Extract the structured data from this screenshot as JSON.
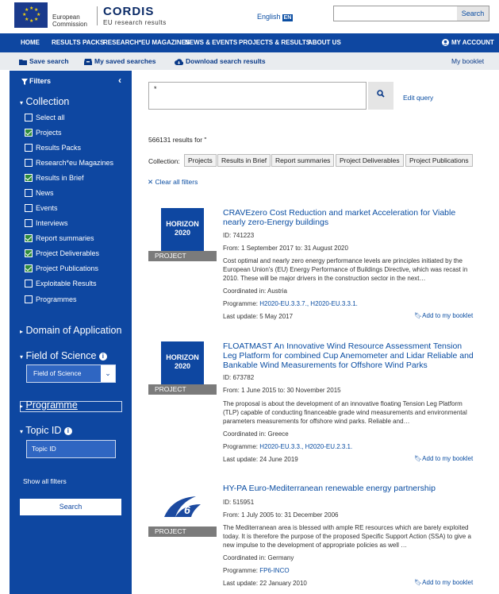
{
  "header": {
    "ec_line1": "European",
    "ec_line2": "Commission",
    "site_name": "CORDIS",
    "site_subtitle": "EU research results",
    "language": "English",
    "language_code": "EN",
    "search_button": "Search",
    "search_value": ""
  },
  "nav": {
    "items": [
      "HOME",
      "RESULTS PACKS",
      "RESEARCH*EU MAGAZINES",
      "NEWS & EVENTS",
      "PROJECTS & RESULTS",
      "ABOUT US"
    ],
    "account": "MY ACCOUNT"
  },
  "toolbar": {
    "save_search": "Save search",
    "saved_searches": "My saved searches",
    "download": "Download search results",
    "booklet": "My booklet"
  },
  "sidebar": {
    "filters": "Filters",
    "collection": {
      "title": "Collection",
      "items": [
        {
          "label": "Select all",
          "checked": false
        },
        {
          "label": "Projects",
          "checked": true
        },
        {
          "label": "Results Packs",
          "checked": false
        },
        {
          "label": "Research*eu Magazines",
          "checked": false
        },
        {
          "label": "Results in Brief",
          "checked": true
        },
        {
          "label": "News",
          "checked": false
        },
        {
          "label": "Events",
          "checked": false
        },
        {
          "label": "Interviews",
          "checked": false
        },
        {
          "label": "Report summaries",
          "checked": true
        },
        {
          "label": "Project Deliverables",
          "checked": true
        },
        {
          "label": "Project Publications",
          "checked": true
        },
        {
          "label": "Exploitable Results",
          "checked": false
        },
        {
          "label": "Programmes",
          "checked": false
        }
      ]
    },
    "domain": "Domain of Application",
    "field_of_science": "Field of Science",
    "field_select": "Field of Science",
    "programme": "Programme",
    "topic_id": "Topic ID",
    "topic_placeholder": "Topic ID",
    "show_all": "Show all filters",
    "search_button": "Search"
  },
  "main": {
    "query": "*",
    "edit_query": "Edit query",
    "results_count": "566131 results for \"",
    "collection_label": "Collection:",
    "chips": [
      "Projects",
      "Results in Brief",
      "Report summaries",
      "Project Deliverables",
      "Project Publications"
    ],
    "clear_filters": "Clear all filters",
    "results": [
      {
        "badge_line1": "HORIZON",
        "badge_line2": "2020",
        "type": "PROJECT",
        "title": "CRAVEzero Cost Reduction and market Acceleration for Viable nearly zero-Energy buildings",
        "id": "ID: 741223",
        "from_label": "From:",
        "from": "1 September 2017",
        "to_label": "to:",
        "to": "31 August 2020",
        "desc": "Cost optimal and nearly zero energy performance levels are principles initiated by the European Union's (EU) Energy Performance of Buildings Directive, which was recast in 2010. These will be major drivers in the construction sector in the next…",
        "coordinated": "Coordinated in: Austria",
        "programme_label": "Programme:",
        "programme": "H2020-EU.3.3.7., H2020-EU.3.3.1.",
        "last_update": "Last update: 5 May 2017",
        "bookmark": "Add to my booklet"
      },
      {
        "badge_line1": "HORIZON",
        "badge_line2": "2020",
        "type": "PROJECT",
        "title": "FLOATMAST An Innovative Wind Resource Assessment Tension Leg Platform for combined Cup Anemometer and Lidar Reliable and Bankable Wind Measurements for Offshore Wind Parks",
        "id": "ID: 673782",
        "from_label": "From:",
        "from": "1 June 2015",
        "to_label": "to:",
        "to": "30 November 2015",
        "desc": "The proposal is about the development of an innovative floating Tension Leg Platform (TLP) capable of conducting financeable grade wind measurements and environmental parameters measurements for offshore wind parks. Reliable and…",
        "coordinated": "Coordinated in: Greece",
        "programme_label": "Programme:",
        "programme": "H2020-EU.3.3., H2020-EU.2.3.1.",
        "last_update": "Last update: 24 June 2019",
        "bookmark": "Add to my booklet"
      },
      {
        "badge_line1": "6",
        "badge_line2": "",
        "type": "PROJECT",
        "title": "HY-PA Euro-Mediterranean renewable energy partnership",
        "id": "ID: 515951",
        "from_label": "From:",
        "from": "1 July 2005",
        "to_label": "to:",
        "to": "31 December 2006",
        "desc": "The Mediterranean area is blessed with ample RE resources which are barely exploited today. It is therefore the purpose of the proposed Specific Support Action (SSA) to give a new impulse to the development of appropriate policies as well …",
        "coordinated": "Coordinated in: Germany",
        "programme_label": "Programme:",
        "programme": "FP6-INCO",
        "last_update": "Last update: 22 January 2010",
        "bookmark": "Add to my booklet"
      }
    ]
  },
  "colors": {
    "brand_blue": "#0e47a1",
    "link_blue": "#0a4da2",
    "check_green": "#2e8b3c"
  }
}
